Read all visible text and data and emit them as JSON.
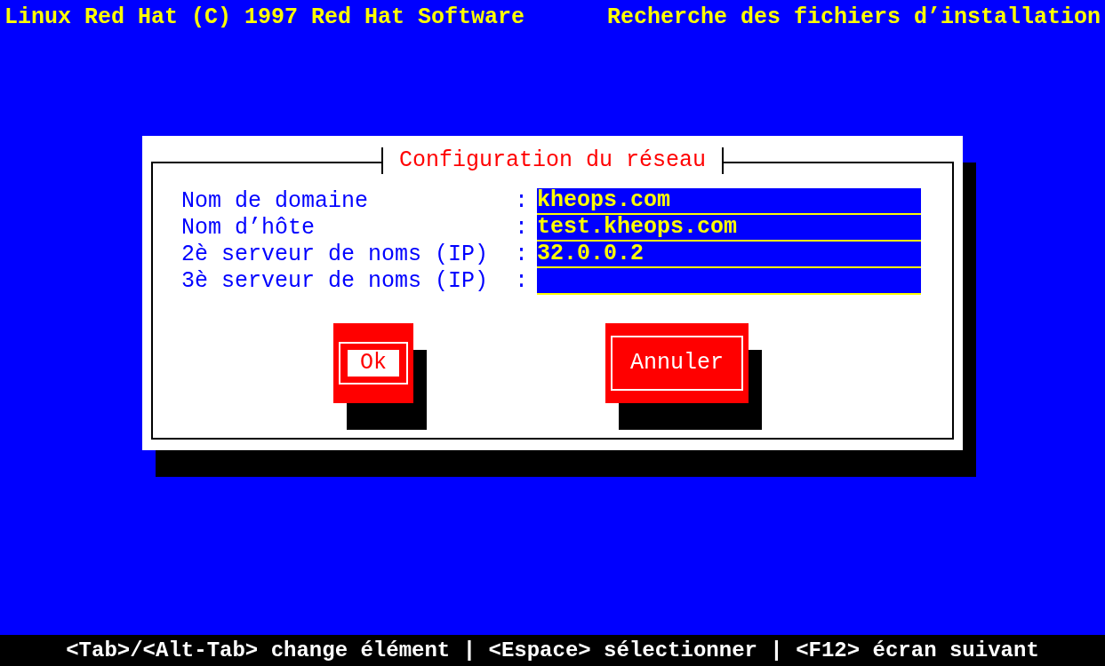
{
  "header": {
    "left": "Linux Red Hat (C) 1997 Red Hat Software",
    "right": "Recherche des fichiers d’installation"
  },
  "dialog": {
    "title": "Configuration du réseau",
    "fields": [
      {
        "label": "Nom de domaine",
        "separator": ":",
        "value": "kheops.com"
      },
      {
        "label": "Nom d’hôte",
        "separator": ":",
        "value": "test.kheops.com"
      },
      {
        "label": "2è serveur de noms (IP)",
        "separator": ":",
        "value": "32.0.0.2"
      },
      {
        "label": "3è serveur de noms (IP)",
        "separator": ":"
      }
    ],
    "buttons": [
      {
        "label": "Ok",
        "focused": true
      },
      {
        "label": "Annuler",
        "focused": false
      }
    ]
  },
  "status_bar": "<Tab>/<Alt-Tab> change élément | <Espace> sélectionner | <F12> écran suivant"
}
